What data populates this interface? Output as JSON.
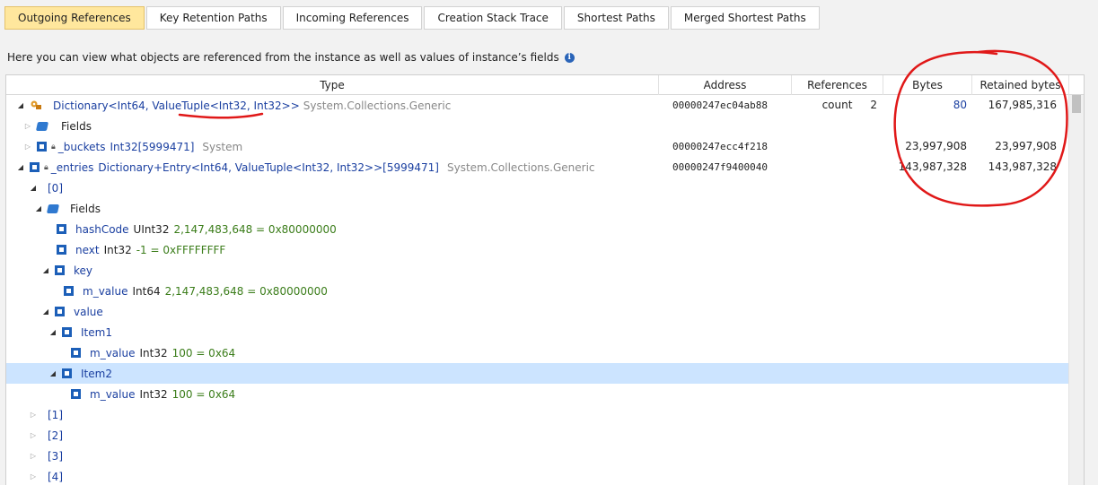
{
  "tabs": [
    {
      "label": "Outgoing References",
      "active": true
    },
    {
      "label": "Key Retention Paths",
      "active": false
    },
    {
      "label": "Incoming References",
      "active": false
    },
    {
      "label": "Creation Stack Trace",
      "active": false
    },
    {
      "label": "Shortest Paths",
      "active": false
    },
    {
      "label": "Merged Shortest Paths",
      "active": false
    }
  ],
  "info_text": "Here you can view what objects are referenced from the instance as well as values of instance’s fields",
  "columns": {
    "type": "Type",
    "address": "Address",
    "refs": "References count",
    "bytes": "Bytes",
    "retained": "Retained bytes"
  },
  "rows": {
    "root": {
      "type": "Dictionary<Int64, ValueTuple<Int32, Int32>>",
      "ns": "System.Collections.Generic",
      "address": "00000247ec04ab88",
      "refs": "2",
      "bytes": "80",
      "retained": "167,985,316"
    },
    "fields": {
      "label": "Fields"
    },
    "buckets": {
      "name": "_buckets",
      "type": "Int32[5999471]",
      "ns": "System",
      "address": "00000247ecc4f218",
      "bytes": "23,997,908",
      "retained": "23,997,908"
    },
    "entries": {
      "name": "_entries",
      "type": "Dictionary+Entry<Int64, ValueTuple<Int32, Int32>>[5999471]",
      "ns": "System.Collections.Generic",
      "address": "00000247f9400040",
      "bytes": "143,987,328",
      "retained": "143,987,328"
    },
    "idx0": {
      "label": "[0]"
    },
    "fields2": {
      "label": "Fields"
    },
    "hashcode": {
      "name": "hashCode",
      "type": "UInt32",
      "value": "2,147,483,648 = 0x80000000"
    },
    "next": {
      "name": "next",
      "type": "Int32",
      "value": "-1 = 0xFFFFFFFF"
    },
    "key": {
      "name": "key"
    },
    "key_mvalue": {
      "name": "m_value",
      "type": "Int64",
      "value": "2,147,483,648 = 0x80000000"
    },
    "value": {
      "name": "value"
    },
    "item1": {
      "name": "Item1"
    },
    "item1_mvalue": {
      "name": "m_value",
      "type": "Int32",
      "value": "100 = 0x64"
    },
    "item2": {
      "name": "Item2"
    },
    "item2_mvalue": {
      "name": "m_value",
      "type": "Int32",
      "value": "100 = 0x64"
    },
    "idx1": {
      "label": "[1]"
    },
    "idx2": {
      "label": "[2]"
    },
    "idx3": {
      "label": "[3]"
    },
    "idx4": {
      "label": "[4]"
    }
  },
  "icons": {
    "expanded": "triangle-down-right",
    "collapsed": "triangle-right",
    "field": "field-icon",
    "fields": "fields-folder-icon",
    "root": "object-root-icon",
    "info": "info-icon"
  },
  "colors": {
    "active_tab": "#ffe79d",
    "selection": "#cce4ff",
    "annotation": "#e01818",
    "value_text": "#3b7d1a",
    "type_text": "#1a3fa0"
  }
}
